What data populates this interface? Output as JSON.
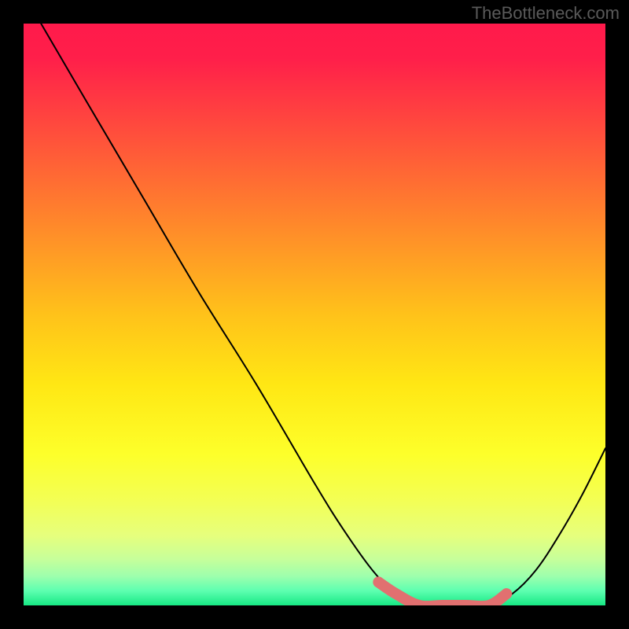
{
  "watermark": "TheBottleneck.com",
  "chart_data": {
    "type": "line",
    "title": "",
    "xlabel": "",
    "ylabel": "",
    "xlim": [
      0,
      100
    ],
    "ylim": [
      0,
      100
    ],
    "grid": false,
    "legend": false,
    "series": [
      {
        "name": "bottleneck-curve",
        "x": [
          3,
          10,
          20,
          30,
          40,
          50,
          55,
          60,
          64,
          68,
          72,
          76,
          80,
          84,
          88,
          92,
          96,
          100
        ],
        "values": [
          100,
          88,
          71,
          54,
          38,
          21,
          13,
          6,
          2,
          0,
          0,
          0,
          0,
          2,
          6,
          12,
          19,
          27
        ]
      }
    ],
    "highlight": {
      "name": "optimal-zone",
      "x": [
        61,
        64,
        68,
        72,
        76,
        80,
        83
      ],
      "values": [
        4,
        2,
        0,
        0,
        0,
        0,
        2
      ]
    },
    "gradient_stops": [
      {
        "pos": 0.0,
        "color": "#ff1a4b"
      },
      {
        "pos": 0.06,
        "color": "#ff1f4a"
      },
      {
        "pos": 0.18,
        "color": "#ff4b3d"
      },
      {
        "pos": 0.35,
        "color": "#ff8a2a"
      },
      {
        "pos": 0.5,
        "color": "#ffc21a"
      },
      {
        "pos": 0.62,
        "color": "#ffe714"
      },
      {
        "pos": 0.74,
        "color": "#fdff2a"
      },
      {
        "pos": 0.82,
        "color": "#f3ff55"
      },
      {
        "pos": 0.88,
        "color": "#e6ff7d"
      },
      {
        "pos": 0.92,
        "color": "#c7ff9a"
      },
      {
        "pos": 0.95,
        "color": "#9dffad"
      },
      {
        "pos": 0.975,
        "color": "#5dffb0"
      },
      {
        "pos": 1.0,
        "color": "#17e884"
      }
    ]
  }
}
